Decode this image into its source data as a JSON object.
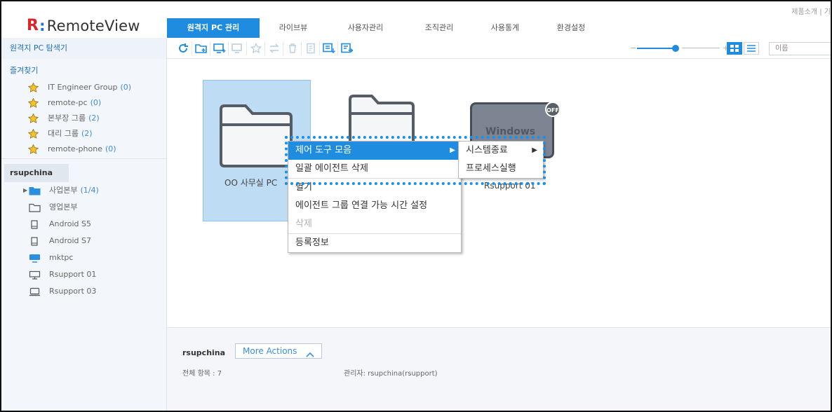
{
  "app": {
    "logo_mark": "R",
    "logo_colon": ":",
    "logo_text": "RemoteView",
    "accent": "#1f8ce0"
  },
  "top_links": "제품소개 | 기",
  "tabs": [
    {
      "label": "원격지 PC 관리",
      "active": true
    },
    {
      "label": "라이브뷰"
    },
    {
      "label": "사용자관리"
    },
    {
      "label": "조직관리"
    },
    {
      "label": "사용통계"
    },
    {
      "label": "환경설정"
    }
  ],
  "toolbar": {
    "explorer_title": "원격지 PC 탐색기",
    "icons": [
      "refresh-icon",
      "new-folder-icon",
      "add-pc-icon",
      "move-pc-icon",
      "favorite-icon",
      "transfer-icon",
      "delete-icon",
      "document-icon",
      "export-icon",
      "register-icon"
    ],
    "zoom_minus": "−",
    "zoom_plus": "+",
    "sort_value": "이름"
  },
  "sidebar": {
    "favorites_title": "즐겨찾기",
    "favorites": [
      {
        "label": "IT Engineer Group",
        "count": "(0)"
      },
      {
        "label": "remote-pc",
        "count": "(0)"
      },
      {
        "label": "본부장 그룹",
        "count": "(2)"
      },
      {
        "label": "대리 그룹",
        "count": "(2)"
      },
      {
        "label": "remote-phone",
        "count": "(0)"
      }
    ],
    "group_label": "rsupchina",
    "tree": [
      {
        "label": "사업본부",
        "count": "(1/4)",
        "icon": "folder-blue-icon",
        "expandable": true
      },
      {
        "label": "영업본부",
        "count": "",
        "icon": "folder-outline-icon"
      },
      {
        "label": "Android S5",
        "count": "",
        "icon": "phone-icon"
      },
      {
        "label": "Android S7",
        "count": "",
        "icon": "phone-icon"
      },
      {
        "label": "mktpc",
        "count": "",
        "icon": "monitor-filled-icon"
      },
      {
        "label": "Rsupport 01",
        "count": "",
        "icon": "monitor-icon"
      },
      {
        "label": "Rsupport 03",
        "count": "",
        "icon": "laptop-icon"
      }
    ]
  },
  "main": {
    "item1_label": "OO 사무실 PC",
    "pc_tile_text": "Windows",
    "off_badge": "OFF",
    "hidden_label": "Rsupport 01"
  },
  "context_menu": {
    "items": [
      {
        "label": "제어 도구 모음",
        "highlighted": true,
        "submenu": true
      },
      {
        "label": "일괄 에이전트 삭제"
      },
      {
        "label": "열기"
      },
      {
        "label": "에이전트 그룹 연결 가능 시간 설정"
      },
      {
        "label": "삭제",
        "disabled": true
      },
      {
        "label": "등록정보"
      }
    ]
  },
  "submenu": {
    "items": [
      {
        "label": "시스템종료",
        "submenu": true
      },
      {
        "label": "프로세스실행"
      }
    ]
  },
  "info": {
    "name": "rsupchina",
    "more_actions": "More Actions",
    "total": "전체 항목 : 7",
    "admin": "관리자: rsupchina(rsupport)"
  }
}
